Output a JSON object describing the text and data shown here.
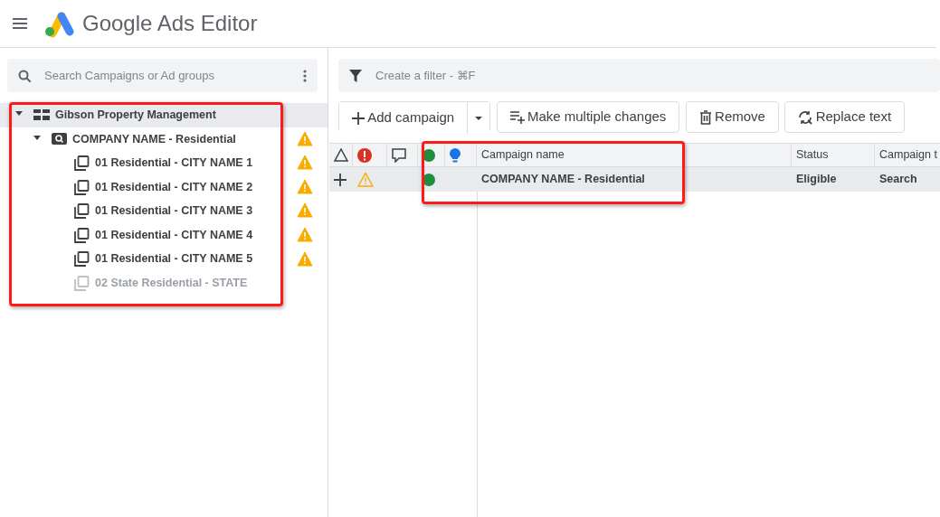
{
  "app": {
    "title": "Google Ads Editor"
  },
  "search": {
    "placeholder": "Search Campaigns or Ad groups"
  },
  "tree": {
    "highlighted": true,
    "items": [
      {
        "kind": "account",
        "label": "Gibson Property Management",
        "expanded": true,
        "selected": true,
        "warning": false,
        "paused": false,
        "children": [
          {
            "kind": "campaign",
            "label": "COMPANY NAME - Residential",
            "expanded": true,
            "selected": false,
            "warning": true,
            "paused": false,
            "children": [
              {
                "kind": "ad_group",
                "label": "01 Residential - CITY NAME 1",
                "selected": false,
                "warning": true,
                "paused": false
              },
              {
                "kind": "ad_group",
                "label": "01 Residential - CITY NAME 2",
                "selected": false,
                "warning": true,
                "paused": false
              },
              {
                "kind": "ad_group",
                "label": "01 Residential - CITY NAME 3",
                "selected": false,
                "warning": true,
                "paused": false
              },
              {
                "kind": "ad_group",
                "label": "01 Residential - CITY NAME 4",
                "selected": false,
                "warning": true,
                "paused": false
              },
              {
                "kind": "ad_group",
                "label": "01 Residential - CITY NAME 5",
                "selected": false,
                "warning": true,
                "paused": false
              },
              {
                "kind": "ad_group",
                "label": "02 State Residential - STATE",
                "selected": false,
                "warning": false,
                "paused": true
              }
            ]
          }
        ]
      }
    ]
  },
  "filter": {
    "placeholder": "Create a filter - ⌘F"
  },
  "toolbar": [
    {
      "kind": "add",
      "label": "Add campaign"
    },
    {
      "kind": "multiple",
      "label": "Make multiple changes"
    },
    {
      "kind": "remove",
      "label": "Remove"
    },
    {
      "kind": "replace",
      "label": "Replace text"
    }
  ],
  "table": {
    "highlighted": true,
    "columns": [
      {
        "kind": "changes"
      },
      {
        "kind": "errors"
      },
      {
        "kind": "comments"
      },
      {
        "kind": "status"
      },
      {
        "kind": "recommendations"
      },
      {
        "kind": "text",
        "label": "Campaign name"
      },
      {
        "kind": "text",
        "label": "Status"
      },
      {
        "kind": "text",
        "label": "Campaign t"
      }
    ],
    "rows": [
      {
        "selected": true,
        "new": true,
        "warning": true,
        "color": "#1e8e3e",
        "cells": [
          "COMPANY NAME - Residential",
          "Eligible",
          "Search"
        ]
      }
    ]
  }
}
